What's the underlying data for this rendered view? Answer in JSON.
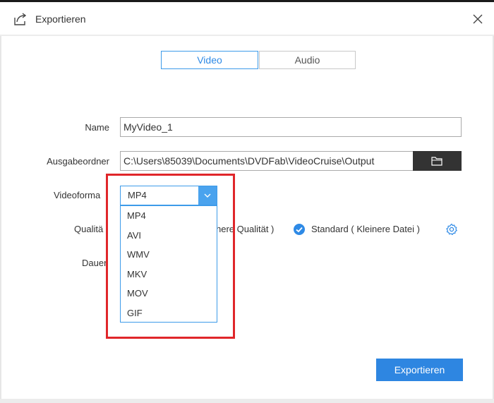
{
  "window": {
    "title": "Exportieren",
    "accent_color": "#2e8ae6",
    "highlight_color": "#e0262a"
  },
  "tabs": [
    {
      "label": "Video",
      "active": true
    },
    {
      "label": "Audio",
      "active": false
    }
  ],
  "form": {
    "name_label": "Name",
    "name_value": "MyVideo_1",
    "output_label": "Ausgabeordner",
    "output_value": "C:\\Users\\85039\\Documents\\DVDFab\\VideoCruise\\Output",
    "format_label": "Videoforma",
    "format_value": "MP4",
    "quality_label": "Qualitä",
    "quality_option_1_partial": "here Qualität )",
    "quality_option_2": "Standard ( Kleinere Datei )",
    "duration_label": "Dauer"
  },
  "format_options": [
    "MP4",
    "AVI",
    "WMV",
    "MKV",
    "MOV",
    "GIF"
  ],
  "export_button": "Exportieren",
  "icons": {
    "title": "export-icon",
    "close": "close-icon",
    "folder": "folder-icon",
    "dropdown": "chevron-down-icon",
    "check": "check-icon",
    "settings": "gear-icon"
  }
}
